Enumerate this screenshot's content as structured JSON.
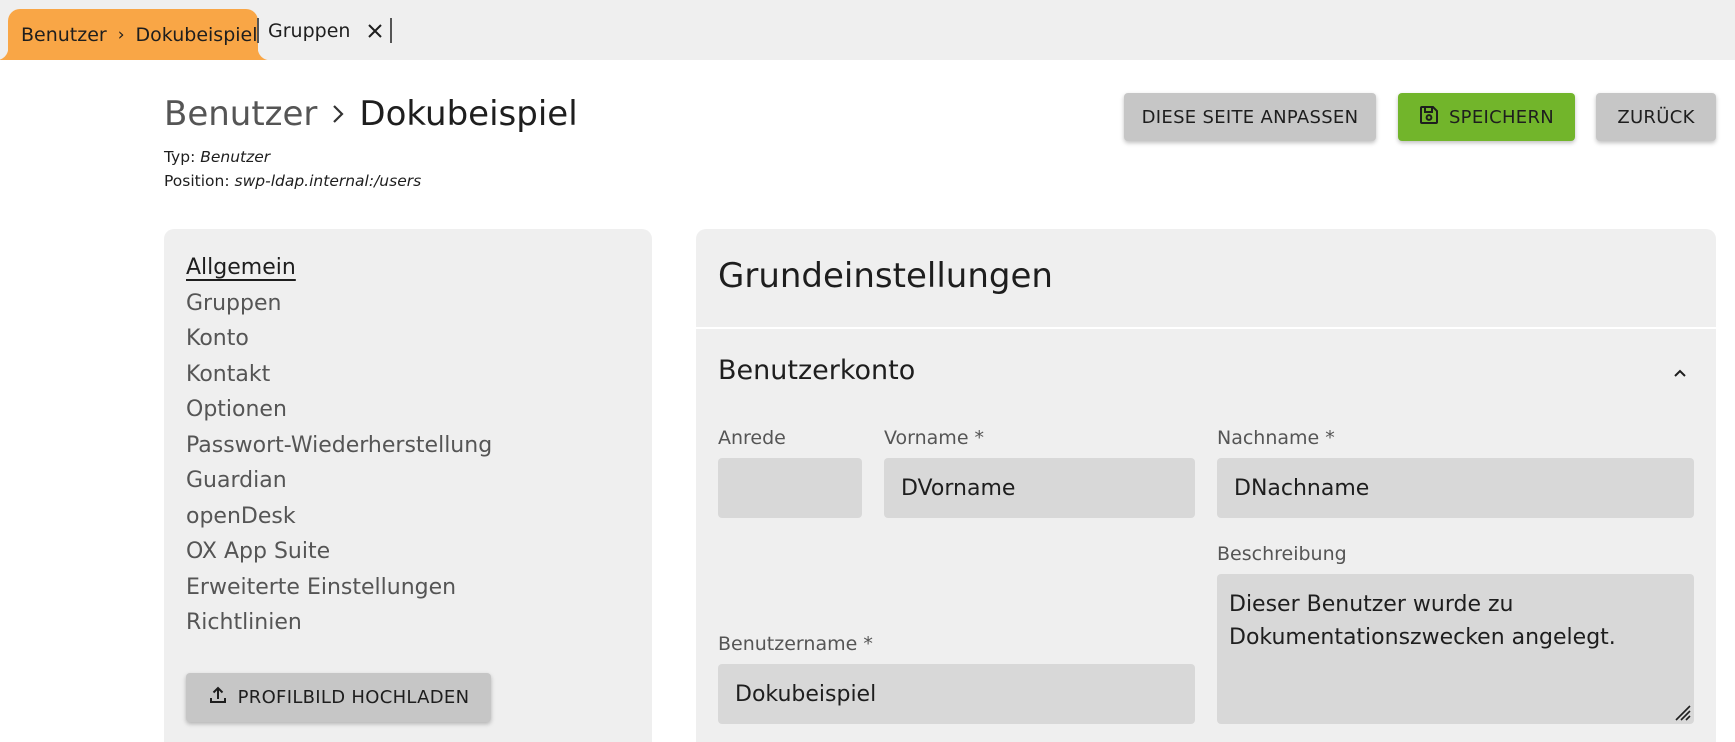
{
  "tabs": {
    "active": {
      "parent": "Benutzer",
      "sep": "›",
      "current": "Dokubeispiel"
    },
    "second": {
      "label": "Gruppen"
    }
  },
  "header": {
    "title_parent": "Benutzer",
    "title_current": "Dokubeispiel",
    "type_label": "Typ",
    "type_value": "Benutzer",
    "position_label": "Position",
    "position_value": "swp-ldap.internal:/users"
  },
  "actions": {
    "customize_label": "DIESE SEITE ANPASSEN",
    "save_label": "SPEICHERN",
    "back_label": "ZURÜCK"
  },
  "sidebar": {
    "items": [
      {
        "label": "Allgemein",
        "active": true
      },
      {
        "label": "Gruppen"
      },
      {
        "label": "Konto"
      },
      {
        "label": "Kontakt"
      },
      {
        "label": "Optionen"
      },
      {
        "label": "Passwort-Wiederherstellung"
      },
      {
        "label": "Guardian"
      },
      {
        "label": "openDesk"
      },
      {
        "label": "OX App Suite"
      },
      {
        "label": "Erweiterte Einstellungen"
      },
      {
        "label": "Richtlinien"
      }
    ],
    "upload_label": "PROFILBILD HOCHLADEN"
  },
  "main": {
    "title": "Grundeinstellungen",
    "section_title": "Benutzerkonto",
    "fields": {
      "salutation": {
        "label": "Anrede",
        "value": ""
      },
      "firstname": {
        "label": "Vorname *",
        "value": "DVorname"
      },
      "lastname": {
        "label": "Nachname *",
        "value": "DNachname"
      },
      "description": {
        "label": "Beschreibung",
        "value": "Dieser Benutzer wurde zu Dokumentationszwecken angelegt."
      },
      "username": {
        "label": "Benutzername *",
        "value": "Dokubeispiel"
      }
    }
  },
  "colors": {
    "active_tab": "#f9a646",
    "save_button": "#72b52b",
    "card_background": "#efefef",
    "input_background": "#d8d8d8"
  },
  "icons": {
    "breadcrumb_separator": "chevron-right-icon",
    "close_tab": "close-icon",
    "save": "floppy-disk-icon",
    "upload": "upload-icon",
    "collapse": "chevron-up-icon",
    "resize": "resize-grip-icon"
  }
}
